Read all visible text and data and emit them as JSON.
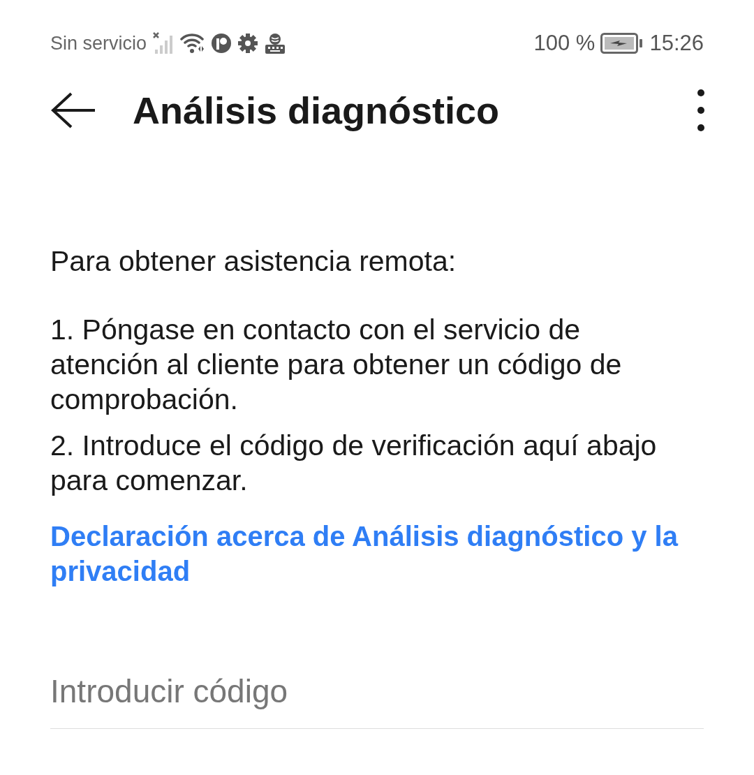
{
  "status_bar": {
    "carrier": "Sin servicio",
    "battery": "100 %",
    "time": "15:26"
  },
  "app_bar": {
    "title": "Análisis diagnóstico"
  },
  "content": {
    "intro": "Para obtener asistencia remota:",
    "steps": [
      "1. Póngase en contacto con el servicio de atención al cliente para obtener un código de comprobación.",
      "2. Introduce el código de verificación aquí abajo para comenzar."
    ],
    "link": "Declaración acerca de Análisis diagnóstico y la privacidad"
  },
  "code_field": {
    "placeholder": "Introducir código"
  }
}
